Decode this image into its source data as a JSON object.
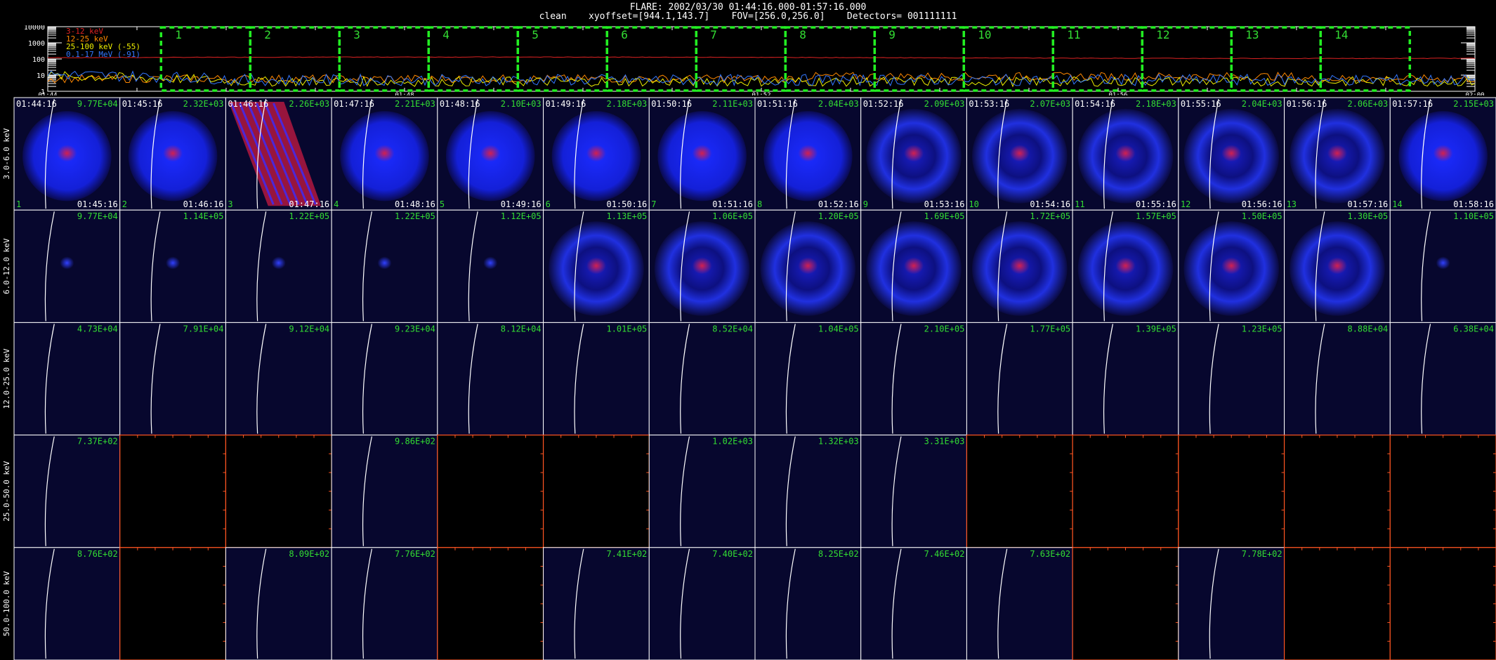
{
  "header": {
    "line1": "FLARE: 2002/03/30 01:44:16.000-01:57:16.000",
    "line2": "clean    xyoffset=[944.1,143.7]    FOV=[256.0,256.0]    Detectors= 001111111"
  },
  "colors": {
    "background": "#000000",
    "panel": "#07072e",
    "annotation": "#33dd33",
    "box": "#22ee22",
    "series_3_12": "#dd2222",
    "series_12_25": "#ff8800",
    "series_25_100": "#eeee00",
    "series_01_17": "#3377ff",
    "limb": "#ffffff",
    "empty_axis": "#ff5522"
  },
  "chart_data": [
    {
      "type": "line",
      "title": "",
      "ylabel": "",
      "yscale": "log",
      "ylim": [
        1,
        10000
      ],
      "y_ticks": [
        "1",
        "10",
        "100",
        "1000",
        "10000"
      ],
      "x_ticks": [
        "01:44",
        "01:48",
        "01:52",
        "01:56",
        "02:00"
      ],
      "legend_placement": "top-left",
      "series": [
        {
          "name": "3-12 keV",
          "color": "#dd2222",
          "level": 120,
          "noise": 0.03
        },
        {
          "name": "12-25 keV",
          "color": "#ff8800",
          "level": 6,
          "noise": 0.25
        },
        {
          "name": "25-100 keV (-55)",
          "color": "#eeee00",
          "level": 4,
          "noise": 0.3
        },
        {
          "name": "0.1-17 MeV (-91)",
          "color": "#3377ff",
          "level": 5,
          "noise": 0.35
        }
      ],
      "intervals": [
        "1",
        "2",
        "3",
        "4",
        "5",
        "6",
        "7",
        "8",
        "9",
        "10",
        "11",
        "12",
        "13",
        "14"
      ]
    },
    {
      "type": "heatmap",
      "row_labels": [
        "3.0-6.0 keV",
        "6.0-12.0 keV",
        "12.0-25.0 keV",
        "25.0-50.0 keV",
        "50.0-100.0 keV"
      ],
      "start_times": [
        "01:44:16",
        "01:45:16",
        "01:46:16",
        "01:47:16",
        "01:48:16",
        "01:49:16",
        "01:50:16",
        "01:51:16",
        "01:52:16",
        "01:53:16",
        "01:54:16",
        "01:55:16",
        "01:56:16",
        "01:57:16"
      ],
      "end_times": [
        "01:45:16",
        "01:46:16",
        "01:47:16",
        "01:48:16",
        "01:49:16",
        "01:50:16",
        "01:51:16",
        "01:52:16",
        "01:53:16",
        "01:54:16",
        "01:55:16",
        "01:56:16",
        "01:57:16",
        "01:58:16"
      ],
      "maxima": [
        [
          "9.77E+04",
          "2.32E+03",
          "2.26E+03",
          "2.21E+03",
          "2.10E+03",
          "2.18E+03",
          "2.11E+03",
          "2.04E+03",
          "2.09E+03",
          "2.07E+03",
          "2.18E+03",
          "2.04E+03",
          "2.06E+03",
          "2.15E+03"
        ],
        [
          "9.77E+04",
          "1.14E+05",
          "1.22E+05",
          "1.22E+05",
          "1.12E+05",
          "1.13E+05",
          "1.06E+05",
          "1.20E+05",
          "1.69E+05",
          "1.72E+05",
          "1.57E+05",
          "1.50E+05",
          "1.30E+05",
          "1.10E+05"
        ],
        [
          "4.73E+04",
          "7.91E+04",
          "9.12E+04",
          "9.23E+04",
          "8.12E+04",
          "1.01E+05",
          "8.52E+04",
          "1.04E+05",
          "2.10E+05",
          "1.77E+05",
          "1.39E+05",
          "1.23E+05",
          "8.88E+04",
          "6.38E+04"
        ],
        [
          "7.37E+02",
          "",
          "",
          "9.86E+02",
          "",
          "",
          "1.02E+03",
          "1.32E+03",
          "3.31E+03",
          "",
          "",
          "",
          "",
          ""
        ],
        [
          "8.76E+02",
          "",
          "8.09E+02",
          "7.76E+02",
          "",
          "7.41E+02",
          "7.40E+02",
          "8.25E+02",
          "7.46E+02",
          "7.63E+02",
          "",
          "7.78E+02",
          "",
          ""
        ]
      ],
      "row_kind": [
        [
          "disk",
          "disk",
          "streak",
          "disk",
          "disk",
          "disk",
          "disk",
          "disk",
          "ring",
          "ring",
          "ring",
          "ring",
          "ring",
          "disk"
        ],
        [
          "dot",
          "dot",
          "dot",
          "dot",
          "dot",
          "ring",
          "ring",
          "ring",
          "ring",
          "ring",
          "ring",
          "ring",
          "ring",
          "dot"
        ],
        [
          "limb",
          "limb",
          "limb",
          "limb",
          "limb",
          "limb",
          "limb",
          "limb",
          "limb",
          "limb",
          "limb",
          "limb",
          "limb",
          "limb"
        ],
        [
          "limb",
          "empty",
          "empty",
          "limb",
          "empty",
          "empty",
          "limb",
          "limb",
          "limb",
          "empty",
          "empty",
          "empty",
          "empty",
          "empty"
        ],
        [
          "limb",
          "empty",
          "limb",
          "limb",
          "empty",
          "limb",
          "limb",
          "limb",
          "limb",
          "limb",
          "empty",
          "limb",
          "empty",
          "empty"
        ]
      ]
    }
  ]
}
